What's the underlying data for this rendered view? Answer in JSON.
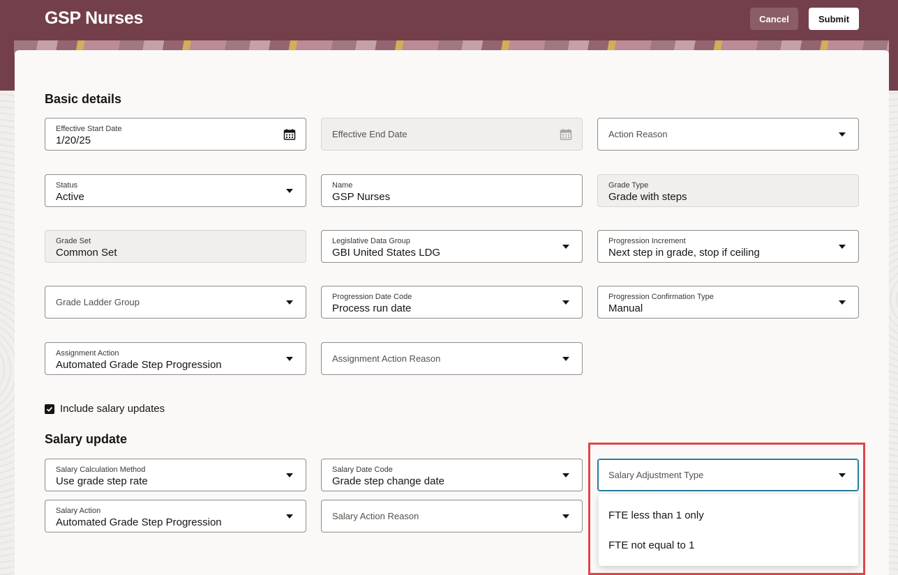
{
  "header": {
    "title": "GSP Nurses",
    "cancel_label": "Cancel",
    "submit_label": "Submit"
  },
  "basic_details": {
    "title": "Basic details",
    "effective_start_date": {
      "label": "Effective Start Date",
      "value": "1/20/25"
    },
    "effective_end_date": {
      "placeholder": "Effective End Date"
    },
    "action_reason": {
      "placeholder": "Action Reason"
    },
    "status": {
      "label": "Status",
      "value": "Active"
    },
    "name": {
      "label": "Name",
      "value": "GSP Nurses"
    },
    "grade_type": {
      "label": "Grade Type",
      "value": "Grade with steps"
    },
    "grade_set": {
      "label": "Grade Set",
      "value": "Common Set"
    },
    "legislative_data_group": {
      "label": "Legislative Data Group",
      "value": "GBI United States LDG"
    },
    "progression_increment": {
      "label": "Progression Increment",
      "value": "Next step in grade, stop if ceiling"
    },
    "grade_ladder_group": {
      "placeholder": "Grade Ladder Group"
    },
    "progression_date_code": {
      "label": "Progression Date Code",
      "value": "Process run date"
    },
    "progression_confirmation_type": {
      "label": "Progression Confirmation Type",
      "value": "Manual"
    },
    "assignment_action": {
      "label": "Assignment Action",
      "value": "Automated Grade Step Progression"
    },
    "assignment_action_reason": {
      "placeholder": "Assignment Action Reason"
    }
  },
  "include_salary": {
    "label": "Include salary updates",
    "checked": true
  },
  "salary_update": {
    "title": "Salary update",
    "salary_calculation_method": {
      "label": "Salary Calculation Method",
      "value": "Use grade step rate"
    },
    "salary_date_code": {
      "label": "Salary Date Code",
      "value": "Grade step change date"
    },
    "salary_adjustment_type": {
      "placeholder": "Salary Adjustment Type"
    },
    "salary_action": {
      "label": "Salary Action",
      "value": "Automated Grade Step Progression"
    },
    "salary_action_reason": {
      "placeholder": "Salary Action Reason"
    },
    "adjustment_options": [
      "FTE less than 1 only",
      "FTE not equal to 1"
    ]
  },
  "colors": {
    "header": "#733f4b",
    "focus": "#227e9e",
    "highlight": "#e1434a"
  }
}
